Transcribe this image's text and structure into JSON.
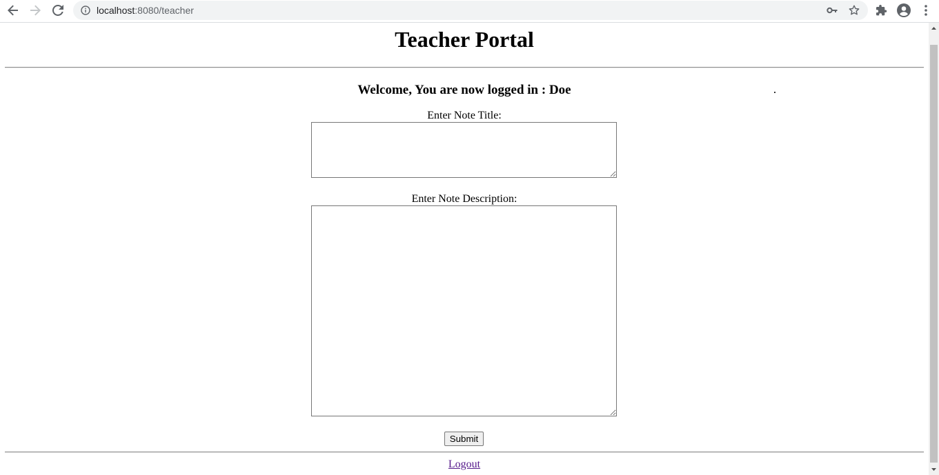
{
  "browser": {
    "url_host": "localhost",
    "url_rest": ":8080/teacher",
    "icons": [
      "back-icon",
      "forward-icon",
      "reload-icon",
      "info-icon",
      "key-icon",
      "star-icon",
      "extensions-icon",
      "profile-icon",
      "menu-icon"
    ]
  },
  "page": {
    "title": "Teacher Portal",
    "welcome": "Welcome, You are now logged in : Doe",
    "note_title_label": "Enter Note Title:",
    "note_title_value": "",
    "note_description_label": "Enter Note Description:",
    "note_description_value": "",
    "submit_label": "Submit",
    "logout_label": "Logout"
  },
  "colors": {
    "link_visited": "#551a8b",
    "chrome_omnibox": "#f1f3f4"
  }
}
